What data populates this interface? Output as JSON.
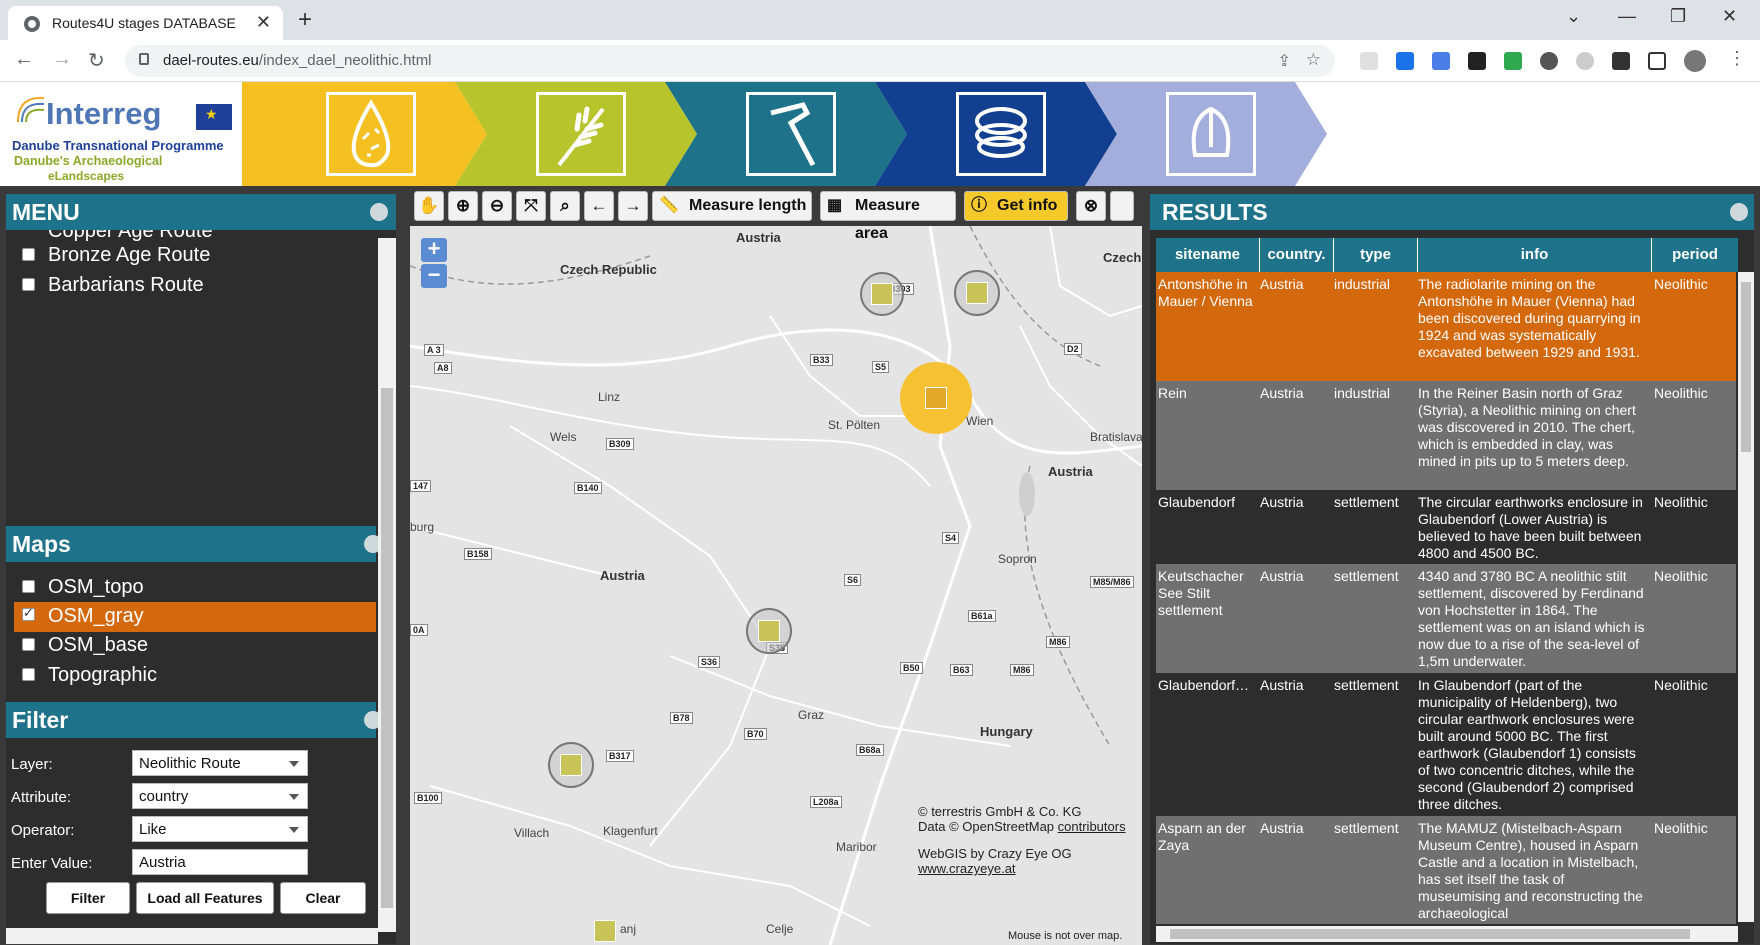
{
  "browser": {
    "tab_title": "Routes4U stages DATABASE",
    "tab_close": "✕",
    "new_tab": "+",
    "url_domain": "dael-routes.eu",
    "url_path": "/index_dael_neolithic.html",
    "win_minimize": "—",
    "win_maximize": "❐",
    "win_close": "✕",
    "win_tablist": "⌄"
  },
  "banner": {
    "logo_word": "Interreg",
    "logo_line1": "Danube Transnational Programme",
    "logo_line2": "Danube's Archaeological",
    "logo_line3": "eLandscapes",
    "stages": [
      {
        "icon": "flint-icon",
        "color": "#f5c022"
      },
      {
        "icon": "wheat-icon",
        "color": "#b8c42c"
      },
      {
        "icon": "axe-icon",
        "color": "#1e728a"
      },
      {
        "icon": "spiral-icon",
        "color": "#123f8f"
      },
      {
        "icon": "helmet-icon",
        "color": "#a3aedc"
      }
    ]
  },
  "menu": {
    "title": "MENU",
    "routes": [
      {
        "label": "Copper Age Route",
        "checked": false
      },
      {
        "label": "Bronze Age Route",
        "checked": false
      },
      {
        "label": "Barbarians Route",
        "checked": false
      }
    ],
    "maps_title": "Maps",
    "maps": [
      {
        "label": "OSM_topo",
        "checked": false
      },
      {
        "label": "OSM_gray",
        "checked": true
      },
      {
        "label": "OSM_base",
        "checked": false
      },
      {
        "label": "Topographic",
        "checked": false
      }
    ],
    "filter_title": "Filter",
    "filter": {
      "layer_label": "Layer:",
      "layer_value": "Neolithic Route",
      "attribute_label": "Attribute:",
      "attribute_value": "country",
      "operator_label": "Operator:",
      "operator_value": "Like",
      "value_label": "Enter Value:",
      "value_value": "Austria",
      "btn_filter": "Filter",
      "btn_load": "Load all Features",
      "btn_clear": "Clear"
    },
    "accent": "#d4680c",
    "header_color": "#1e728a"
  },
  "map": {
    "toolbar": {
      "measure_length": "Measure length",
      "measure_area": "Measure area",
      "get_info": "Get info"
    },
    "zoom_in": "+",
    "zoom_out": "−",
    "labels": {
      "austria_top": "Austria",
      "czech_republic": "Czech Republic",
      "czech": "Czech",
      "linz": "Linz",
      "wels": "Wels",
      "st_poelten": "St. Pölten",
      "wien": "Wien",
      "bratislava": "Bratislava",
      "austria_mid": "Austria",
      "austria_east": "Austria",
      "sopron": "Sopron",
      "graz": "Graz",
      "hungary": "Hungary",
      "villach": "Villach",
      "klagenfurt": "Klagenfurt",
      "maribor": "Maribor",
      "celje": "Celje",
      "burg": "burg",
      "anj": "anj"
    },
    "roads": [
      "B303",
      "A 3",
      "A8",
      "B33",
      "S5",
      "D2",
      "B309",
      "B140",
      "147",
      "S4",
      "B158",
      "M85/M86",
      "S6",
      "B61a",
      "S35",
      "S36",
      "B50",
      "B63",
      "M86",
      "M86",
      "B70",
      "B78",
      "B317",
      "B68a",
      "B100",
      "L208a",
      "0A"
    ],
    "credits_line1": "© terrestris GmbH & Co. KG",
    "credits_line2_prefix": "Data © OpenStreetMap ",
    "credits_line2_link": "contributors",
    "credits_line3": "WebGIS by Crazy Eye OG",
    "credits_line4": "www.crazyeye.at",
    "mouse_status": "Mouse is not over map."
  },
  "results": {
    "title": "RESULTS",
    "columns": [
      "sitename",
      "country.",
      "type",
      "info",
      "period"
    ],
    "rows": [
      {
        "sitename": "Antonshöhe in Mauer / Vienna",
        "country": "Austria",
        "type": "industrial",
        "info": "The radiolarite mining on the Antonshöhe in Mauer (Vienna) had been discovered during quarrying in 1924 and was systematically excavated between 1929 and 1931.",
        "period": "Neolithic",
        "bg": "#d4680c"
      },
      {
        "sitename": "Rein",
        "country": "Austria",
        "type": "industrial",
        "info": "In the Reiner Basin north of Graz (Styria), a Neolithic mining on chert was discovered in 2010. The chert, which is embedded in clay, was mined in pits up to 5 meters deep.",
        "period": "Neolithic",
        "bg": "#707070"
      },
      {
        "sitename": "Glaubendorf",
        "country": "Austria",
        "type": "settlement",
        "info": "The circular earthworks enclosure in Glaubendorf (Lower Austria) is believed to have been built between 4800 and 4500 BC.",
        "period": "Neolithic",
        "bg": "#2d2d2d"
      },
      {
        "sitename": "Keutschacher See Stilt settlement",
        "country": "Austria",
        "type": "settlement",
        "info": "4340 and 3780 BC A neolithic stilt settlement, discovered by Ferdinand von Hochstetter in 1864. The settlement was on an island which is now due to a rise of the sea-level of 1,5m underwater.",
        "period": "Neolithic",
        "bg": "#707070"
      },
      {
        "sitename": "Glaubendorf…",
        "country": "Austria",
        "type": "settlement",
        "info": "In Glaubendorf (part of the municipality of Heldenberg), two circular earthwork enclosures were built around 5000 BC. The first earthwork (Glaubendorf 1) consists of two concentric ditches, while the second (Glaubendorf 2) comprised three ditches.",
        "period": "Neolithic",
        "bg": "#2d2d2d"
      },
      {
        "sitename": "Asparn an der Zaya",
        "country": "Austria",
        "type": "settlement",
        "info": "The MAMUZ (Mistelbach-Asparn Museum Centre), housed in Asparn Castle and a location in Mistelbach, has set itself the task of museumising and reconstructing the archaeological",
        "period": "Neolithic",
        "bg": "#707070"
      }
    ]
  }
}
